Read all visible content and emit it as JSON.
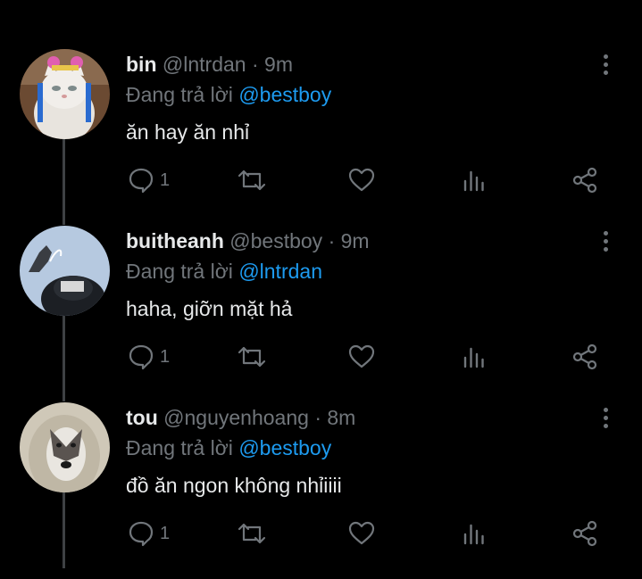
{
  "tweets": [
    {
      "name": "bin",
      "handle": "@lntrdan",
      "sep": "·",
      "time": "9m",
      "reply_prefix": "Đang trả lời",
      "reply_to": "@bestboy",
      "text": "ăn hay ăn nhỉ",
      "reply_count": "1",
      "avatar": "cat-avatar"
    },
    {
      "name": "buitheanh",
      "handle": "@bestboy",
      "sep": "·",
      "time": "9m",
      "reply_prefix": "Đang trả lời",
      "reply_to": "@lntrdan",
      "text": "haha, giỡn mặt hả",
      "reply_count": "1",
      "avatar": "person-avatar"
    },
    {
      "name": "tou",
      "handle": "@nguyenhoang",
      "sep": "·",
      "time": "8m",
      "reply_prefix": "Đang trả lời",
      "reply_to": "@bestboy",
      "text": "đồ ăn ngon không nhỉiiii",
      "reply_count": "1",
      "avatar": "husky-avatar"
    }
  ],
  "colors": {
    "background": "#000000",
    "text": "#e7e9ea",
    "muted": "#71767b",
    "accent": "#1d9bf0",
    "thread_line": "#3e4144"
  }
}
